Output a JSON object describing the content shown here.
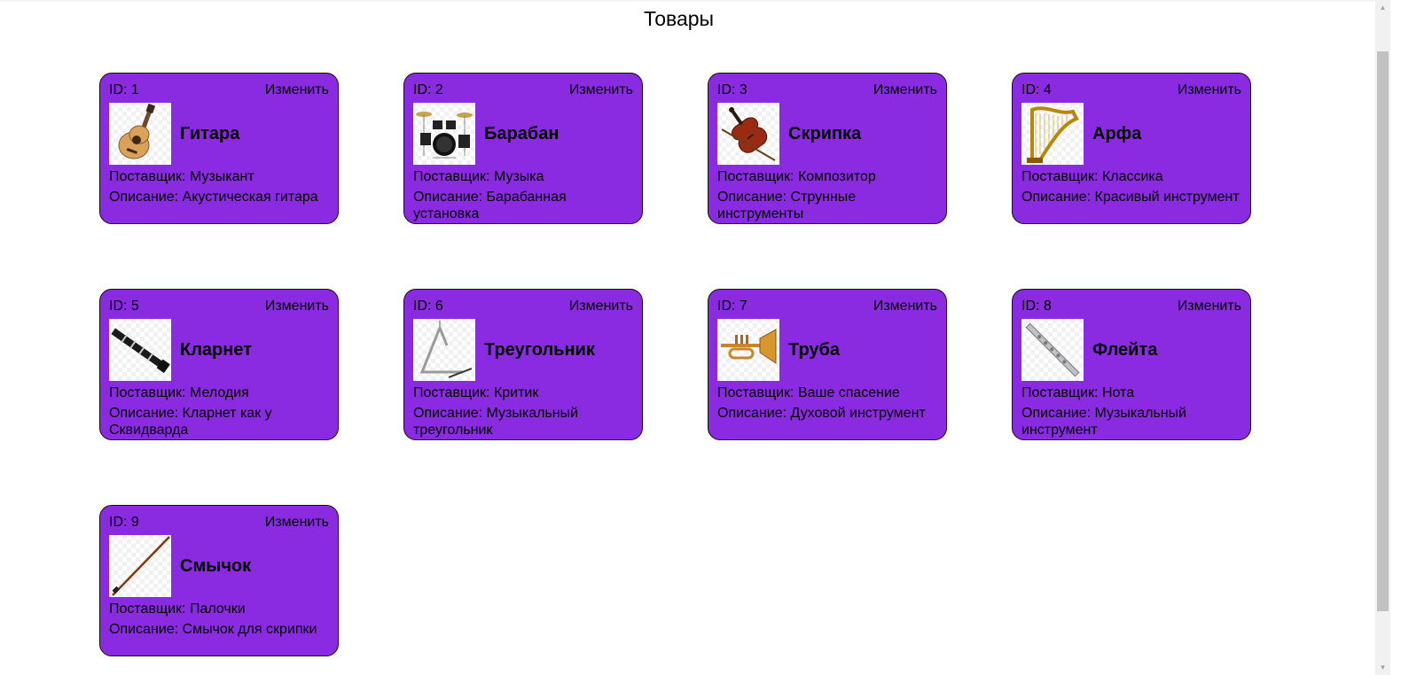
{
  "page": {
    "title": "Товары"
  },
  "labels": {
    "id_prefix": "ID: ",
    "edit": "Изменить",
    "supplier_prefix": "Поставщик: ",
    "description_prefix": "Описание: "
  },
  "colors": {
    "card_background": "#8a2be2",
    "card_border": "#111111",
    "page_background": "#ffffff"
  },
  "products": [
    {
      "id": "1",
      "name": "Гитара",
      "supplier": "Музыкант",
      "description": "Акустическая гитара",
      "icon": "guitar-icon"
    },
    {
      "id": "2",
      "name": "Барабан",
      "supplier": "Музыка",
      "description": "Барабанная установка",
      "icon": "drum-kit-icon"
    },
    {
      "id": "3",
      "name": "Скрипка",
      "supplier": "Композитор",
      "description": "Струнные инструменты",
      "icon": "violin-icon"
    },
    {
      "id": "4",
      "name": "Арфа",
      "supplier": "Классика",
      "description": "Красивый инструмент",
      "icon": "harp-icon"
    },
    {
      "id": "5",
      "name": "Кларнет",
      "supplier": "Мелодия",
      "description": "Кларнет как у Сквидварда",
      "icon": "clarinet-icon"
    },
    {
      "id": "6",
      "name": "Треугольник",
      "supplier": "Критик",
      "description": "Музыкальный треугольник",
      "icon": "triangle-icon"
    },
    {
      "id": "7",
      "name": "Труба",
      "supplier": "Ваше спасение",
      "description": "Духовой инструмент",
      "icon": "trumpet-icon"
    },
    {
      "id": "8",
      "name": "Флейта",
      "supplier": "Нота",
      "description": "Музыкальный инструмент",
      "icon": "flute-icon"
    },
    {
      "id": "9",
      "name": "Смычок",
      "supplier": "Палочки",
      "description": "Смычок для скрипки",
      "icon": "bow-icon"
    }
  ]
}
